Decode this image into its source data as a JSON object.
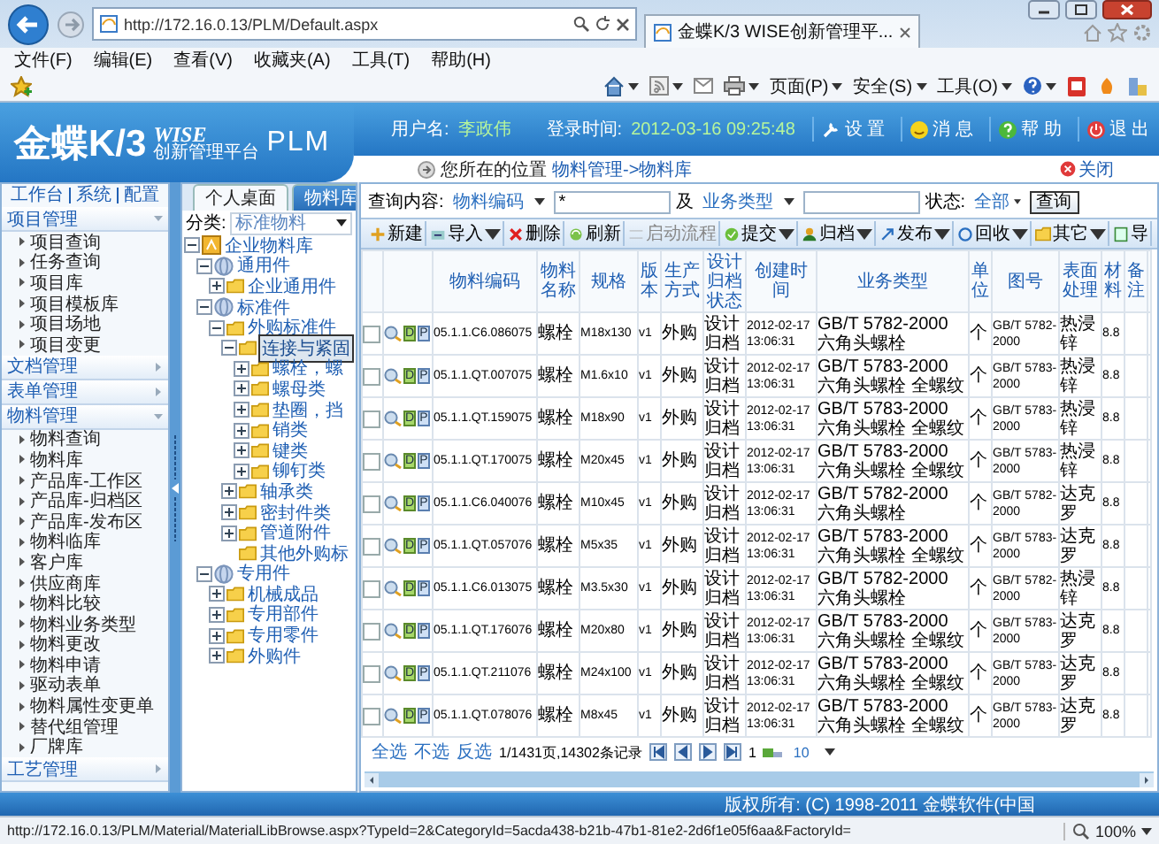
{
  "browser": {
    "url": "http://172.16.0.13/PLM/Default.aspx",
    "tab_title": "金蝶K/3 WISE创新管理平...",
    "menu": [
      "文件(F)",
      "编辑(E)",
      "查看(V)",
      "收藏夹(A)",
      "工具(T)",
      "帮助(H)"
    ],
    "command_menus": [
      "页面(P)",
      "安全(S)",
      "工具(O)"
    ]
  },
  "header": {
    "logo": "金蝶K/3",
    "logo_wise": "WISE",
    "logo_tagline": "创新管理平台",
    "logo_product": "PLM",
    "user_label": "用户名:",
    "user": "李政伟",
    "login_label": "登录时间:",
    "login_time": "2012-03-16 09:25:48",
    "actions": [
      "设 置",
      "消 息",
      "帮 助",
      "退 出"
    ]
  },
  "breadcrumb": {
    "label": "您所在的位置",
    "path": "物料管理->物料库",
    "close": "关闭"
  },
  "sidebar": {
    "links": [
      "工作台",
      "系统",
      "配置"
    ],
    "groups": [
      {
        "title": "项目管理",
        "expanded": true,
        "items": [
          "项目查询",
          "任务查询",
          "项目库",
          "项目模板库",
          "项目场地",
          "项目变更"
        ]
      },
      {
        "title": "文档管理",
        "expanded": false
      },
      {
        "title": "表单管理",
        "expanded": false
      },
      {
        "title": "物料管理",
        "expanded": true,
        "items": [
          "物料查询",
          "物料库",
          "产品库-工作区",
          "产品库-归档区",
          "产品库-发布区",
          "物料临库",
          "客户库",
          "供应商库",
          "物料比较",
          "物料业务类型",
          "物料更改",
          "物料申请",
          "驱动表单",
          "物料属性变更单",
          "替代组管理",
          "厂牌库"
        ]
      },
      {
        "title": "工艺管理",
        "expanded": false
      }
    ]
  },
  "tree_panel": {
    "tabs": [
      {
        "label": "个人桌面",
        "selected": false
      },
      {
        "label": "物料库",
        "selected": true
      }
    ],
    "category_label": "分类:",
    "category_value": "标准物料",
    "tree": [
      {
        "label": "企业物料库",
        "kind": "root",
        "expanded": true,
        "selected": false,
        "children": [
          {
            "label": "通用件",
            "kind": "category",
            "expanded": true,
            "selected": false,
            "children": [
              {
                "label": "企业通用件",
                "kind": "folder",
                "expanded": false,
                "selected": false
              }
            ]
          },
          {
            "label": "标准件",
            "kind": "category",
            "expanded": true,
            "selected": false,
            "children": [
              {
                "label": "外购标准件",
                "kind": "folder",
                "expanded": true,
                "selected": false,
                "children": [
                  {
                    "label": "连接与紧固",
                    "kind": "folder",
                    "expanded": true,
                    "selected": true,
                    "children": [
                      {
                        "label": "螺栓，螺",
                        "kind": "folder",
                        "expanded": false,
                        "selected": false
                      },
                      {
                        "label": "螺母类",
                        "kind": "folder",
                        "expanded": false,
                        "selected": false
                      },
                      {
                        "label": "垫圈，挡",
                        "kind": "folder",
                        "expanded": false,
                        "selected": false
                      },
                      {
                        "label": "销类",
                        "kind": "folder",
                        "expanded": false,
                        "selected": false
                      },
                      {
                        "label": "键类",
                        "kind": "folder",
                        "expanded": false,
                        "selected": false
                      },
                      {
                        "label": "铆钉类",
                        "kind": "folder",
                        "expanded": false,
                        "selected": false
                      }
                    ]
                  },
                  {
                    "label": "轴承类",
                    "kind": "folder",
                    "expanded": false,
                    "selected": false
                  },
                  {
                    "label": "密封件类",
                    "kind": "folder",
                    "expanded": false,
                    "selected": false
                  },
                  {
                    "label": "管道附件",
                    "kind": "folder",
                    "expanded": false,
                    "selected": false
                  },
                  {
                    "label": "其他外购标",
                    "kind": "leaf",
                    "selected": false
                  }
                ]
              }
            ]
          },
          {
            "label": "专用件",
            "kind": "category",
            "expanded": true,
            "selected": false,
            "children": [
              {
                "label": "机械成品",
                "kind": "folder",
                "expanded": false,
                "selected": false
              },
              {
                "label": "专用部件",
                "kind": "folder",
                "expanded": false,
                "selected": false
              },
              {
                "label": "专用零件",
                "kind": "folder",
                "expanded": false,
                "selected": false
              },
              {
                "label": "外购件",
                "kind": "folder",
                "expanded": false,
                "selected": false
              }
            ]
          }
        ]
      }
    ]
  },
  "grid": {
    "query_label": "查询内容:",
    "field_1": "物料编码",
    "value_1": "*",
    "and_label": "及",
    "field_2": "业务类型",
    "status_label": "状态:",
    "status_value": "全部",
    "query_button": "查询",
    "toolbar": [
      {
        "label": "新建",
        "dropdown": false,
        "disabled": false
      },
      {
        "label": "导入",
        "dropdown": true,
        "disabled": false
      },
      {
        "label": "删除",
        "dropdown": false,
        "disabled": false
      },
      {
        "label": "刷新",
        "dropdown": false,
        "disabled": false
      },
      {
        "label": "启动流程",
        "dropdown": false,
        "disabled": true
      },
      {
        "label": "提交",
        "dropdown": true,
        "disabled": false
      },
      {
        "label": "归档",
        "dropdown": true,
        "disabled": false
      },
      {
        "label": "发布",
        "dropdown": true,
        "disabled": false
      },
      {
        "label": "回收",
        "dropdown": true,
        "disabled": false
      },
      {
        "label": "其它",
        "dropdown": true,
        "disabled": false
      },
      {
        "label": "导",
        "dropdown": false,
        "disabled": false
      }
    ],
    "columns": [
      "物料编码",
      "物料名称",
      "规格",
      "版本",
      "生产方式",
      "设计归档状态",
      "创建时间",
      "业务类型",
      "单位",
      "图号",
      "表面处理",
      "材料",
      "备注"
    ],
    "rows": [
      {
        "checked": false,
        "actions": [
          "D",
          "P"
        ],
        "cells": [
          "05.1.1.C6.086075",
          "螺栓",
          "M18x130",
          "v1",
          "外购",
          "设计归档",
          "2012-02-17 13:06:31",
          "GB/T 5782-2000 六角头螺栓",
          "个",
          "GB/T 5782-2000",
          "热浸锌",
          "8.8"
        ]
      },
      {
        "checked": false,
        "actions": [
          "D",
          "P"
        ],
        "cells": [
          "05.1.1.QT.007075",
          "螺栓",
          "M1.6x10",
          "v1",
          "外购",
          "设计归档",
          "2012-02-17 13:06:31",
          "GB/T 5783-2000 六角头螺栓 全螺纹",
          "个",
          "GB/T 5783-2000",
          "热浸锌",
          "8.8"
        ]
      },
      {
        "checked": false,
        "actions": [
          "D",
          "P"
        ],
        "cells": [
          "05.1.1.QT.159075",
          "螺栓",
          "M18x90",
          "v1",
          "外购",
          "设计归档",
          "2012-02-17 13:06:31",
          "GB/T 5783-2000 六角头螺栓 全螺纹",
          "个",
          "GB/T 5783-2000",
          "热浸锌",
          "8.8"
        ]
      },
      {
        "checked": false,
        "actions": [
          "D",
          "P"
        ],
        "cells": [
          "05.1.1.QT.170075",
          "螺栓",
          "M20x45",
          "v1",
          "外购",
          "设计归档",
          "2012-02-17 13:06:31",
          "GB/T 5783-2000 六角头螺栓 全螺纹",
          "个",
          "GB/T 5783-2000",
          "热浸锌",
          "8.8"
        ]
      },
      {
        "checked": false,
        "actions": [
          "D",
          "P"
        ],
        "cells": [
          "05.1.1.C6.040076",
          "螺栓",
          "M10x45",
          "v1",
          "外购",
          "设计归档",
          "2012-02-17 13:06:31",
          "GB/T 5782-2000 六角头螺栓",
          "个",
          "GB/T 5782-2000",
          "达克罗",
          "8.8"
        ]
      },
      {
        "checked": false,
        "actions": [
          "D",
          "P"
        ],
        "cells": [
          "05.1.1.QT.057076",
          "螺栓",
          "M5x35",
          "v1",
          "外购",
          "设计归档",
          "2012-02-17 13:06:31",
          "GB/T 5783-2000 六角头螺栓 全螺纹",
          "个",
          "GB/T 5783-2000",
          "达克罗",
          "8.8"
        ]
      },
      {
        "checked": false,
        "actions": [
          "D",
          "P"
        ],
        "cells": [
          "05.1.1.C6.013075",
          "螺栓",
          "M3.5x30",
          "v1",
          "外购",
          "设计归档",
          "2012-02-17 13:06:31",
          "GB/T 5782-2000 六角头螺栓",
          "个",
          "GB/T 5782-2000",
          "热浸锌",
          "8.8"
        ]
      },
      {
        "checked": false,
        "actions": [
          "D",
          "P"
        ],
        "cells": [
          "05.1.1.QT.176076",
          "螺栓",
          "M20x80",
          "v1",
          "外购",
          "设计归档",
          "2012-02-17 13:06:31",
          "GB/T 5783-2000 六角头螺栓 全螺纹",
          "个",
          "GB/T 5783-2000",
          "达克罗",
          "8.8"
        ]
      },
      {
        "checked": false,
        "actions": [
          "D",
          "P"
        ],
        "cells": [
          "05.1.1.QT.211076",
          "螺栓",
          "M24x100",
          "v1",
          "外购",
          "设计归档",
          "2012-02-17 13:06:31",
          "GB/T 5783-2000 六角头螺栓 全螺纹",
          "个",
          "GB/T 5783-2000",
          "达克罗",
          "8.8"
        ]
      },
      {
        "checked": false,
        "actions": [
          "D",
          "P"
        ],
        "cells": [
          "05.1.1.QT.078076",
          "螺栓",
          "M8x45",
          "v1",
          "外购",
          "设计归档",
          "2012-02-17 13:06:31",
          "GB/T 5783-2000 六角头螺栓 全螺纹",
          "个",
          "GB/T 5783-2000",
          "达克罗",
          "8.8"
        ]
      }
    ],
    "pager": {
      "select_all": "全选",
      "select_none": "不选",
      "invert": "反选",
      "summary": "1/1431页,14302条记录",
      "page": "1",
      "page_size": "10"
    }
  },
  "footer": {
    "copyright": "版权所有: (C) 1998-2011 金蝶软件(中国"
  },
  "status_bar": {
    "url": "http://172.16.0.13/PLM/Material/MaterialLibBrowse.aspx?TypeId=2&CategoryId=5acda438-b21b-47b1-81e2-2d6f1e05f6aa&FactoryId=",
    "zoom": "100%"
  }
}
